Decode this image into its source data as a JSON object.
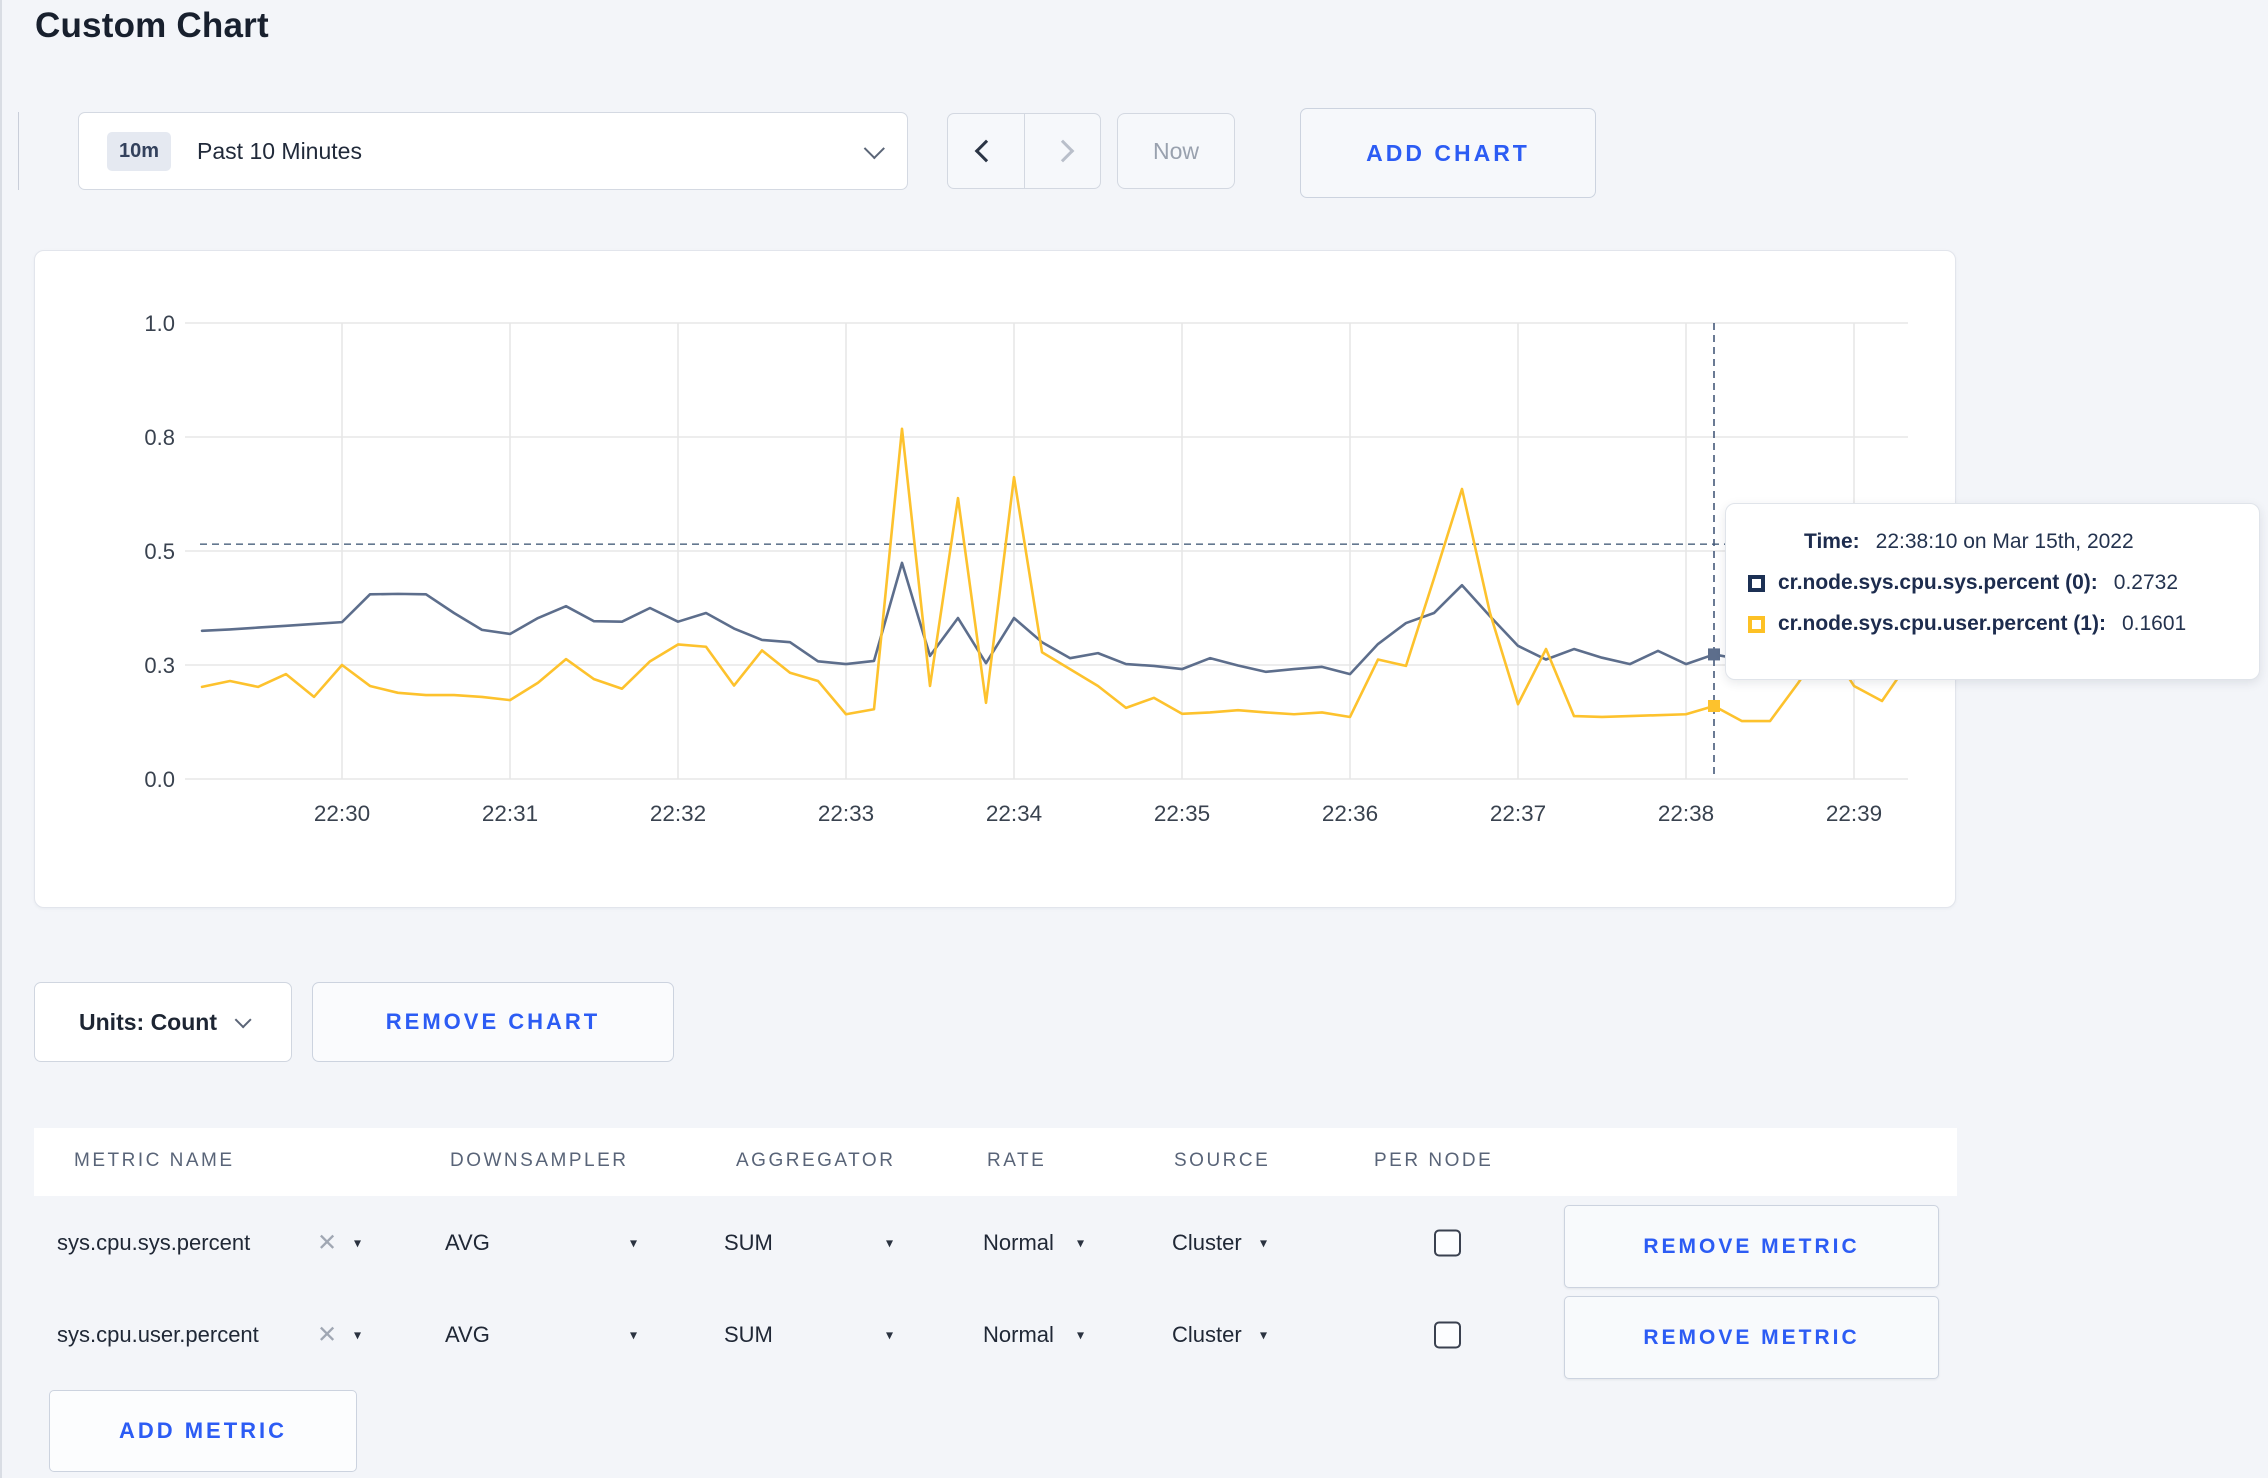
{
  "page": {
    "title": "Custom Chart"
  },
  "toolbar": {
    "range_badge": "10m",
    "range_label": "Past 10 Minutes",
    "prev_label": "previous time window",
    "next_label": "next time window",
    "now_label": "Now",
    "add_chart_label": "ADD CHART"
  },
  "chart_data": {
    "type": "line",
    "title": "",
    "xlabel": "",
    "ylabel": "",
    "ylim": [
      0,
      1
    ],
    "grid": true,
    "legend_position": "none",
    "x_ticks": [
      "22:30",
      "22:31",
      "22:32",
      "22:33",
      "22:34",
      "22:35",
      "22:36",
      "22:37",
      "22:38",
      "22:39"
    ],
    "y_tick_labels": [
      "0.0",
      "0.3",
      "0.5",
      "0.8",
      "1.0"
    ],
    "y_tick_values": [
      0,
      0.25,
      0.5,
      0.75,
      1.0
    ],
    "x_start_time": "22:29:10",
    "x_interval_seconds": 10,
    "hover_index": 54,
    "hover_time": "22:38:10",
    "hover_line_value": 0.515,
    "series": [
      {
        "name": "cr.node.sys.cpu.sys.percent",
        "color": "#5d6e8c",
        "values": [
          0.325,
          0.328,
          0.332,
          0.336,
          0.34,
          0.344,
          0.405,
          0.406,
          0.405,
          0.364,
          0.327,
          0.318,
          0.353,
          0.379,
          0.346,
          0.345,
          0.375,
          0.345,
          0.364,
          0.33,
          0.305,
          0.3,
          0.258,
          0.252,
          0.259,
          0.474,
          0.27,
          0.353,
          0.254,
          0.353,
          0.3,
          0.265,
          0.276,
          0.252,
          0.248,
          0.241,
          0.265,
          0.249,
          0.235,
          0.241,
          0.246,
          0.23,
          0.296,
          0.342,
          0.364,
          0.425,
          0.357,
          0.292,
          0.262,
          0.285,
          0.266,
          0.252,
          0.281,
          0.252,
          0.2732,
          0.262,
          0.252,
          0.262,
          0.272,
          0.262,
          0.272,
          0.268
        ]
      },
      {
        "name": "cr.node.sys.cpu.user.percent",
        "color": "#fdc22d",
        "values": [
          0.202,
          0.215,
          0.202,
          0.23,
          0.18,
          0.25,
          0.204,
          0.189,
          0.184,
          0.184,
          0.18,
          0.173,
          0.211,
          0.263,
          0.219,
          0.198,
          0.258,
          0.295,
          0.29,
          0.205,
          0.282,
          0.233,
          0.215,
          0.142,
          0.153,
          0.768,
          0.204,
          0.616,
          0.167,
          0.662,
          0.278,
          0.241,
          0.204,
          0.156,
          0.178,
          0.143,
          0.146,
          0.151,
          0.146,
          0.142,
          0.146,
          0.136,
          0.262,
          0.248,
          0.44,
          0.636,
          0.364,
          0.164,
          0.285,
          0.138,
          0.136,
          0.138,
          0.14,
          0.142,
          0.1601,
          0.127,
          0.127,
          0.21,
          0.3,
          0.204,
          0.171,
          0.26
        ]
      }
    ]
  },
  "tooltip": {
    "time_label": "Time:",
    "time_value": "22:38:10 on Mar 15th, 2022",
    "rows": [
      {
        "label": "cr.node.sys.cpu.sys.percent (0):",
        "value": "0.2732",
        "color": "#1c3054"
      },
      {
        "label": "cr.node.sys.cpu.user.percent (1):",
        "value": "0.1601",
        "color": "#fdc125"
      }
    ]
  },
  "chart_footer": {
    "units_label": "Units: Count",
    "remove_chart_label": "REMOVE CHART"
  },
  "metrics_table": {
    "headers": [
      "METRIC NAME",
      "DOWNSAMPLER",
      "AGGREGATOR",
      "RATE",
      "SOURCE",
      "PER NODE"
    ],
    "rows": [
      {
        "metric": "sys.cpu.sys.percent",
        "downsampler": "AVG",
        "aggregator": "SUM",
        "rate": "Normal",
        "source": "Cluster",
        "per_node_checked": false,
        "remove_label": "REMOVE METRIC"
      },
      {
        "metric": "sys.cpu.user.percent",
        "downsampler": "AVG",
        "aggregator": "SUM",
        "rate": "Normal",
        "source": "Cluster",
        "per_node_checked": false,
        "remove_label": "REMOVE METRIC"
      }
    ],
    "remove_icon": "✕",
    "caret_icon": "▾",
    "add_metric_label": "ADD METRIC"
  }
}
